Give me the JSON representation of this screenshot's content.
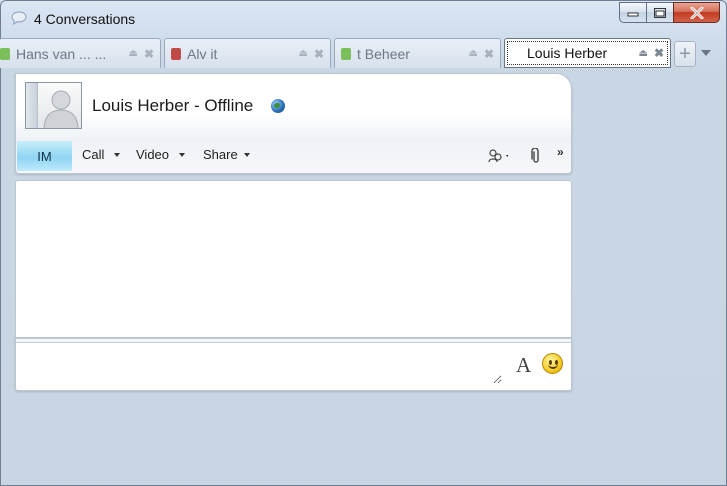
{
  "window": {
    "title": "4 Conversations",
    "icon": "speech-bubble-icon",
    "caption_buttons": [
      "minimize-icon",
      "maximize-icon",
      "close-icon"
    ]
  },
  "tabs": [
    {
      "label": "Hans van ... ...",
      "status_color": "#7bbf5a",
      "active": false
    },
    {
      "label": "Alv     it",
      "status_color": "#c24a46",
      "active": false
    },
    {
      "label": "      t Beheer",
      "status_color": "#7bbf5a",
      "active": false
    },
    {
      "label": "Louis Herber",
      "status_color": "",
      "active": true
    }
  ],
  "tab_actions": {
    "new_tab_icon": "plus-icon",
    "menu_icon": "chevron-down-icon"
  },
  "contact": {
    "name_status": "Louis Herber - Offline",
    "avatar": "default-avatar",
    "location_icon": "globe-icon"
  },
  "toolbar": {
    "im_label": "IM",
    "call_label": "Call",
    "video_label": "Video",
    "share_label": "Share",
    "people_icon": "people-icon",
    "attach_icon": "paperclip-icon",
    "overflow_label": "»"
  },
  "compose": {
    "value": "",
    "font_label": "A",
    "emoticon_icon": "smiley-icon"
  },
  "colors": {
    "im_tab_accent": "#8fd5f2",
    "close_button": "#c33b22",
    "window_bg": "#c9d6e4"
  }
}
